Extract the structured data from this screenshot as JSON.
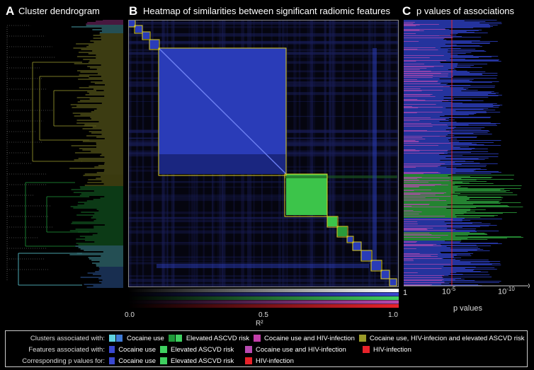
{
  "panels": {
    "a": {
      "letter": "A",
      "title": "Cluster dendrogram"
    },
    "b": {
      "letter": "B",
      "title": "Heatmap of similarities between significant radiomic features"
    },
    "c": {
      "letter": "C",
      "title": "p values of associations"
    }
  },
  "colorbar": {
    "ticks": [
      "0.0",
      "0.5",
      "1.0"
    ],
    "label": "R²"
  },
  "pvalue_axis": {
    "label": "p values",
    "ticks": [
      {
        "base": "1",
        "exp": ""
      },
      {
        "base": "10",
        "exp": "-5"
      },
      {
        "base": "10",
        "exp": "-10"
      }
    ]
  },
  "legend": {
    "rows": [
      {
        "head": "Clusters associated with:",
        "items": [
          {
            "label": "Cocaine use",
            "colors": [
              "#5fd3e0",
              "#3f7ad6"
            ]
          },
          {
            "label": "Elevated ASCVD risk",
            "colors": [
              "#1f9a3a",
              "#3fd060"
            ]
          },
          {
            "label": "Cocaine use and HIV-infection",
            "colors": [
              "#c23fa8"
            ]
          },
          {
            "label": "Cocaine use, HIV-infecion and elevated ASCVD risk",
            "colors": [
              "#9a9a28"
            ]
          }
        ]
      },
      {
        "head": "Features associated with:",
        "items": [
          {
            "label": "Cocaine use",
            "colors": [
              "#3a48d0"
            ]
          },
          {
            "label": "Elevated ASCVD risk",
            "colors": [
              "#3fd060"
            ]
          },
          {
            "label": "Cocaine use and HIV-infection",
            "colors": [
              "#b84ab0"
            ]
          },
          {
            "label": "HIV-infection",
            "colors": [
              "#e8222a"
            ]
          }
        ]
      },
      {
        "head": "Corresponding p values for:",
        "items": [
          {
            "label": "Cocaine use",
            "colors": [
              "#3a48d0"
            ]
          },
          {
            "label": "Elevated ASCVD risk",
            "colors": [
              "#3fd060"
            ]
          },
          {
            "label": "HIV-infection",
            "colors": [
              "#e8222a"
            ]
          }
        ]
      }
    ]
  },
  "colors": {
    "frame": "#e0d020",
    "blue": "#3a48d0",
    "green": "#3fd060",
    "pink": "#c23fa8",
    "red": "#e8222a",
    "cyan": "#5fd3e0",
    "olive": "#9a9a28"
  }
}
